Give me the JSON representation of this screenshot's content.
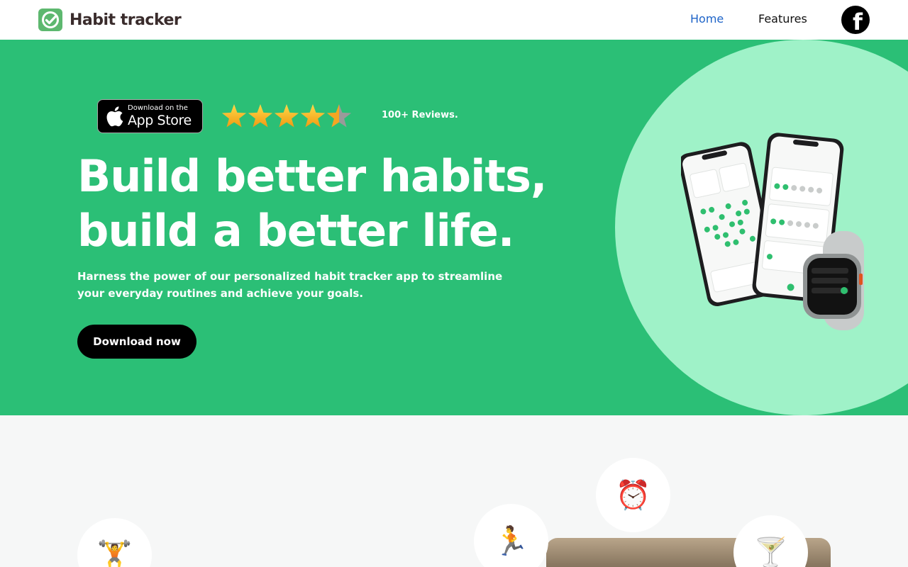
{
  "header": {
    "logo_text": "Habit tracker",
    "nav": [
      {
        "label": "Home",
        "active": true
      },
      {
        "label": "Features",
        "active": false
      }
    ],
    "social_icon": "facebook-icon"
  },
  "hero": {
    "app_store": {
      "small_text": "Download on the",
      "big_text": "App Store"
    },
    "rating": 4.5,
    "rating_max": 5,
    "reviews_label": "100+ Reviews.",
    "headline_line1": "Build better habits,",
    "headline_line2": "build a better life.",
    "subheadline": "Harness the power of our personalized habit tracker app to streamline your everyday routines and achieve your goals.",
    "cta_label": "Download now",
    "image": "phone-and-watch-mockup"
  },
  "habit_icons": [
    {
      "name": "weightlifter-emoji",
      "glyph": "🏋"
    },
    {
      "name": "runner-emoji",
      "glyph": "🏃"
    },
    {
      "name": "alarm-clock-emoji",
      "glyph": "⏰"
    },
    {
      "name": "no-alcohol-emoji",
      "glyph": "🍸"
    }
  ],
  "colors": {
    "hero_bg": "#2bbf76",
    "circle_bg": "#9ff2c8",
    "nav_active": "#1e64c8",
    "logo_green": "#5db86f",
    "star": "#f5a623"
  }
}
